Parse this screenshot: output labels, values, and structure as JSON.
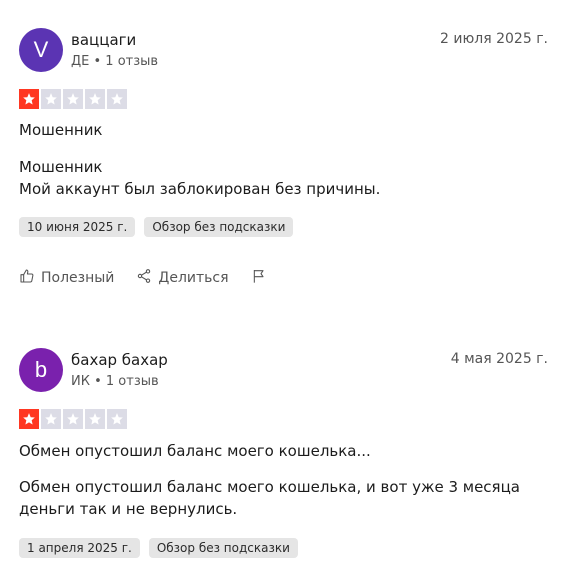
{
  "reviews": [
    {
      "avatar_letter": "V",
      "avatar_color": "#5b34b3",
      "name": "ваццаги",
      "meta": "ДЕ • 1 отзыв",
      "date": "2 июля 2025 г.",
      "rating": 1,
      "title": "Мошенник",
      "body_line1": "Мошенник",
      "body_line2": "Мой аккаунт был заблокирован без причины.",
      "tag_date": "10 июня 2025 г.",
      "tag_label": "Обзор без подсказки",
      "actions": {
        "helpful": "Полезный",
        "share": "Делиться"
      }
    },
    {
      "avatar_letter": "b",
      "avatar_color": "#7a21ad",
      "name": "бахар бахар",
      "meta": "ИК • 1 отзыв",
      "date": "4 мая 2025 г.",
      "rating": 1,
      "title": "Обмен опустошил баланс моего кошелька...",
      "body": "Обмен опустошил баланс моего кошелька, и вот уже 3 месяца деньги так и не вернулись.",
      "tag_date": "1 апреля 2025 г.",
      "tag_label": "Обзор без подсказки"
    }
  ],
  "colors": {
    "star_filled": "#ff3722",
    "star_empty": "#dcdce6"
  }
}
